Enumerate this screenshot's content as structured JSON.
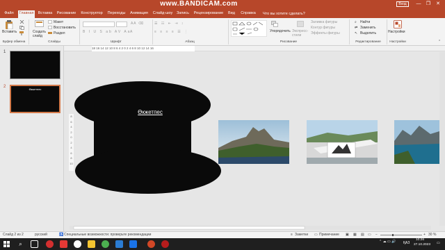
{
  "watermark": "www.BANDICAM.com",
  "titlebar": {
    "signin_label": "Вход",
    "minimize": "—",
    "restore": "❐",
    "close": "✕"
  },
  "tabs": [
    {
      "label": "Файл"
    },
    {
      "label": "Главная"
    },
    {
      "label": "Вставка"
    },
    {
      "label": "Рисование"
    },
    {
      "label": "Конструктор"
    },
    {
      "label": "Переходы"
    },
    {
      "label": "Анимация"
    },
    {
      "label": "Слайд-шоу"
    },
    {
      "label": "Запись"
    },
    {
      "label": "Рецензирование"
    },
    {
      "label": "Вид"
    },
    {
      "label": "Справка"
    }
  ],
  "tellme": "Что вы хотите сделать?",
  "ribbon": {
    "clipboard": {
      "paste": "Вставить",
      "group": "Буфер обмена"
    },
    "slides": {
      "new_slide": "Создать слайд",
      "layout": "Макет",
      "reset": "Восстановить",
      "section": "Раздел",
      "group": "Слайды"
    },
    "font": {
      "group": "Шрифт"
    },
    "paragraph": {
      "group": "Абзац"
    },
    "drawing": {
      "arrange": "Упорядочить",
      "quick_styles": "Экспресс-стили",
      "fill": "Заливка фигуры",
      "outline": "Контур фигуры",
      "effects": "Эффекты фигуры",
      "group": "Рисование"
    },
    "editing": {
      "find": "Найти",
      "replace": "Заменить",
      "select": "Выделить",
      "group": "Редактирование"
    },
    "designer": {
      "label": "Настройки",
      "group": "Настройки"
    }
  },
  "ruler_marks": "18 16 14 12 10 8 6 4 2 0 2 4 6 8 10 12 14 16",
  "vruler_marks": [
    "8",
    "6",
    "4",
    "2",
    "0",
    "2",
    "4",
    "6",
    "8",
    "10"
  ],
  "slides": [
    {
      "number": "1",
      "title": ""
    },
    {
      "number": "2",
      "title": "Өкжетпес"
    }
  ],
  "slide": {
    "title": "Өкжетпес"
  },
  "status": {
    "slide_of": "Слайд 2 из 2",
    "language": "русский",
    "accessibility": "Специальные возможности: проверьте рекомендации",
    "notes": "Заметки",
    "comments": "Примечание",
    "zoom": "30 %"
  },
  "taskbar": {
    "lang": "ҚАЗ",
    "time": "10:26",
    "date": "27.10.2023"
  },
  "colors": {
    "accent": "#b7472a",
    "slide_bg": "#0a0a0a",
    "taskbar": "#1f1f1f"
  }
}
